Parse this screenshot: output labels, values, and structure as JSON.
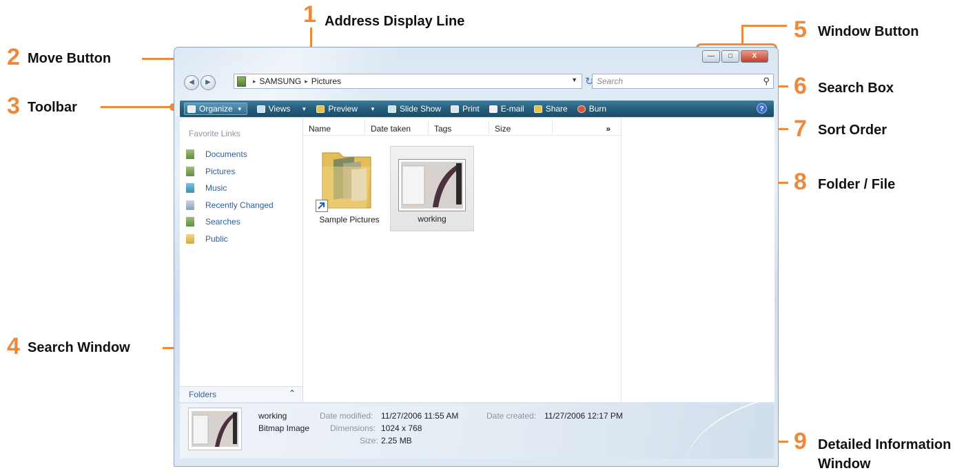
{
  "callouts": [
    {
      "num": "1",
      "label": "Address Display Line"
    },
    {
      "num": "2",
      "label": "Move Button"
    },
    {
      "num": "3",
      "label": "Toolbar"
    },
    {
      "num": "4",
      "label": "Search Window"
    },
    {
      "num": "5",
      "label": "Window Button"
    },
    {
      "num": "6",
      "label": "Search Box"
    },
    {
      "num": "7",
      "label": "Sort Order"
    },
    {
      "num": "8",
      "label": "Folder / File"
    },
    {
      "num": "9",
      "label": "Detailed Information",
      "label2": "Window"
    }
  ],
  "window": {
    "buttons": {
      "minimize": "—",
      "maximize": "□",
      "close": "X"
    },
    "address": {
      "segments": [
        "SAMSUNG",
        "Pictures"
      ],
      "separator": "▸"
    },
    "search_placeholder": "Search",
    "toolbar": [
      {
        "label": "Organize",
        "caret": "▼",
        "icon": "organize-icon"
      },
      {
        "label": "Views",
        "caret": "▼",
        "icon": "views-icon"
      },
      {
        "label": "Preview",
        "caret": "▼",
        "icon": "preview-icon"
      },
      {
        "label": "Slide Show",
        "icon": "slideshow-icon"
      },
      {
        "label": "Print",
        "icon": "printer-icon"
      },
      {
        "label": "E-mail",
        "icon": "email-icon"
      },
      {
        "label": "Share",
        "icon": "share-icon"
      },
      {
        "label": "Burn",
        "icon": "burn-icon"
      }
    ],
    "help": "?",
    "favorite_links": {
      "header": "Favorite Links",
      "items": [
        "Documents",
        "Pictures",
        "Music",
        "Recently Changed",
        "Searches",
        "Public"
      ]
    },
    "folders_label": "Folders",
    "folders_caret": "⌃",
    "columns": [
      "Name",
      "Date taken",
      "Tags",
      "Size",
      "»"
    ],
    "items": [
      {
        "name": "Sample Pictures",
        "type": "folder-shortcut"
      },
      {
        "name": "working",
        "type": "image"
      }
    ],
    "details": {
      "name": "working",
      "type": "Bitmap Image",
      "date_modified_label": "Date modified:",
      "date_modified": "11/27/2006 11:55 AM",
      "date_created_label": "Date created:",
      "date_created": "11/27/2006 12:17 PM",
      "dimensions_label": "Dimensions:",
      "dimensions": "1024 x 768",
      "size_label": "Size:",
      "size": "2.25 MB"
    }
  },
  "colors": {
    "callout": "#f0883a",
    "toolbar": "#245b78",
    "link": "#2a5fa0"
  }
}
